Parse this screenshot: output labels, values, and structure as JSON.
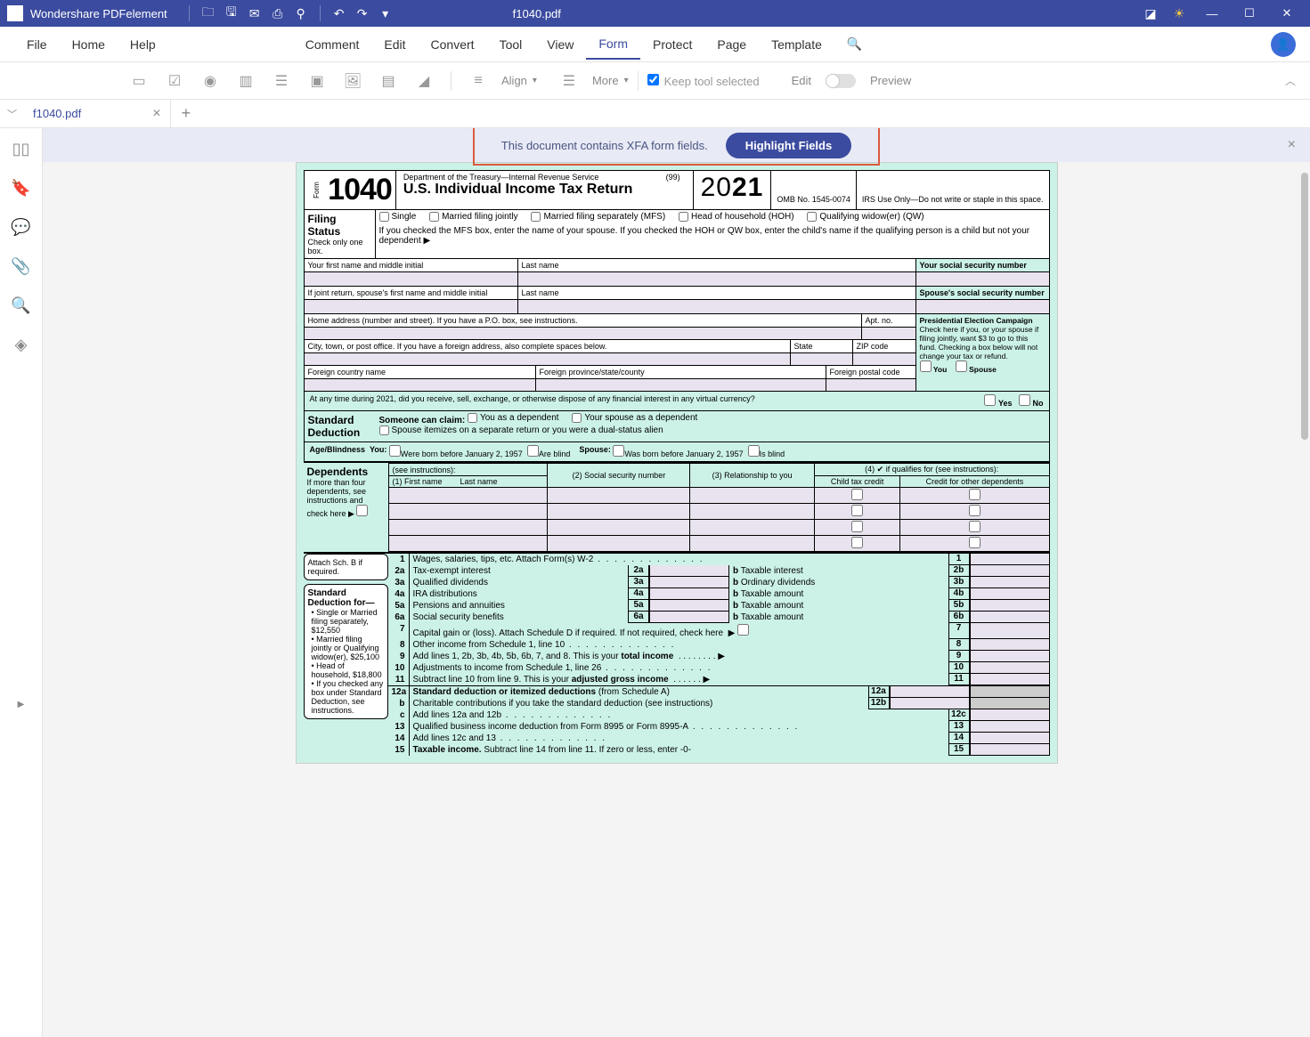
{
  "app": {
    "name": "Wondershare PDFelement",
    "file": "f1040.pdf"
  },
  "menu": {
    "file": "File",
    "home": "Home",
    "help": "Help",
    "comment": "Comment",
    "edit": "Edit",
    "convert": "Convert",
    "tool": "Tool",
    "view": "View",
    "form": "Form",
    "protect": "Protect",
    "page": "Page",
    "template": "Template"
  },
  "toolbar": {
    "align": "Align",
    "more": "More",
    "keep": "Keep tool selected",
    "edit": "Edit",
    "preview": "Preview"
  },
  "tab": {
    "name": "f1040.pdf"
  },
  "xfa": {
    "msg": "This document contains XFA form fields.",
    "btn": "Highlight Fields"
  },
  "form": {
    "num": "1040",
    "form_word": "Form",
    "dept": "Department of the Treasury—Internal Revenue Service",
    "title": "U.S. Individual Income Tax Return",
    "n99": "(99)",
    "year": "2021",
    "year_p1": "20",
    "year_p2": "21",
    "omb": "OMB No. 1545-0074",
    "irs": "IRS Use Only—Do not write or staple in this space.",
    "filing": {
      "h": "Filing Status",
      "sub": "Check only one box.",
      "single": "Single",
      "mfj": "Married filing jointly",
      "mfs": "Married filing separately (MFS)",
      "hoh": "Head of household (HOH)",
      "qw": "Qualifying widow(er) (QW)",
      "note": "If you checked the MFS box, enter the name of your spouse. If you checked the HOH or QW box, enter the child's name if the qualifying person is a child but not your dependent ▶"
    },
    "name": {
      "first": "Your first name and middle initial",
      "last": "Last name",
      "ssn": "Your social security number",
      "spfirst": "If joint return, spouse's first name and middle initial",
      "splast": "Last name",
      "spssn": "Spouse's social security number",
      "addr": "Home address (number and street). If you have a P.O. box, see instructions.",
      "apt": "Apt. no.",
      "city": "City, town, or post office. If you have a foreign address, also complete spaces below.",
      "state": "State",
      "zip": "ZIP code",
      "fcountry": "Foreign country name",
      "fprov": "Foreign province/state/county",
      "fpost": "Foreign postal code"
    },
    "pec": {
      "h": "Presidential Election Campaign",
      "txt": "Check here if you, or your spouse if filing jointly, want $3 to go to this fund. Checking a box below will not change your tax or refund.",
      "you": "You",
      "spouse": "Spouse"
    },
    "crypto": {
      "q": "At any time during 2021, did you receive, sell, exchange, or otherwise dispose of any financial interest in any virtual currency?",
      "yes": "Yes",
      "no": "No"
    },
    "std": {
      "h": "Standard Deduction",
      "someone": "Someone can claim:",
      "youdep": "You as a dependent",
      "spdep": "Your spouse as a dependent",
      "itemize": "Spouse itemizes on a separate return or you were a dual-status alien"
    },
    "age": {
      "h": "Age/Blindness",
      "you": "You:",
      "b1": "Were born before January 2, 1957",
      "b2": "Are blind",
      "sp": "Spouse:",
      "b3": "Was born before January 2, 1957",
      "b4": "Is blind"
    },
    "dep": {
      "h": "Dependents",
      "see": "(see instructions):",
      "c1": "(1) First name",
      "c1b": "Last name",
      "c2": "(2) Social security number",
      "c3": "(3) Relationship to you",
      "c4": "(4) ✔ if qualifies for (see instructions):",
      "c4a": "Child tax credit",
      "c4b": "Credit for other dependents",
      "more": "If more than four dependents, see instructions and check here ▶"
    },
    "attach": "Attach Sch. B if required.",
    "sdfor": {
      "h": "Standard Deduction for—",
      "l1": "Single or Married filing separately, $12,550",
      "l2": "Married filing jointly or Qualifying widow(er), $25,100",
      "l3": "Head of household, $18,800",
      "l4": "If you checked any box under Standard Deduction, see instructions."
    },
    "lines": {
      "l1": "Wages, salaries, tips, etc. Attach Form(s) W-2",
      "l2a": "Tax-exempt interest",
      "l2b": "Taxable interest",
      "l3a": "Qualified dividends",
      "l3b": "Ordinary dividends",
      "l4a": "IRA distributions",
      "l4b": "Taxable amount",
      "l5a": "Pensions and annuities",
      "l5b": "Taxable amount",
      "l6a": "Social security benefits",
      "l6b": "Taxable amount",
      "l7": "Capital gain or (loss). Attach Schedule D if required. If not required, check here",
      "l8": "Other income from Schedule 1, line 10",
      "l9": "Add lines 1, 2b, 3b, 4b, 5b, 6b, 7, and 8. This is your ",
      "l9b": "total income",
      "l10": "Adjustments to income from Schedule 1, line 26",
      "l11": "Subtract line 10 from line 9. This is your ",
      "l11b": "adjusted gross income",
      "l12a": "Standard deduction or itemized deductions ",
      "l12a2": "(from Schedule A)",
      "l12b": "Charitable contributions if you take the standard deduction (see instructions)",
      "l12c": "Add lines 12a and 12b",
      "l13": "Qualified business income deduction from Form 8995 or Form 8995-A",
      "l14": "Add lines 12c and 13",
      "l15": "Taxable income. ",
      "l15b": "Subtract line 14 from line 11. If zero or less, enter -0-"
    },
    "b": "b"
  }
}
